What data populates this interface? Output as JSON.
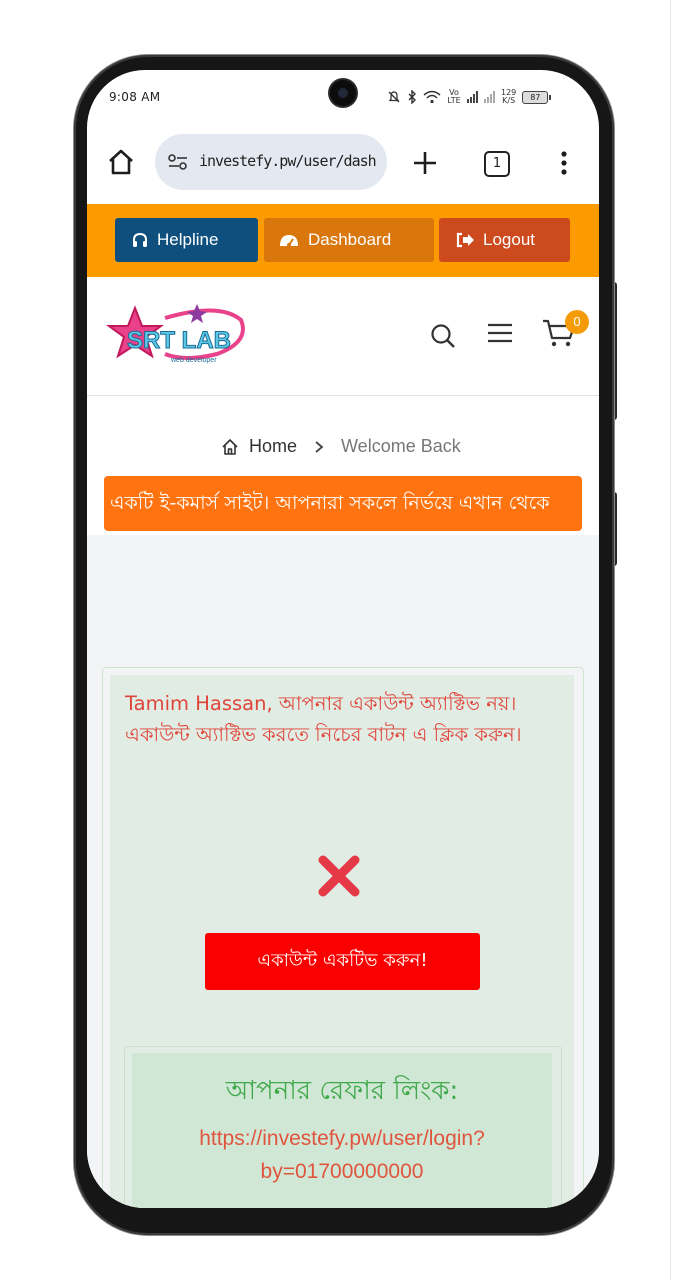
{
  "status_bar": {
    "time": "9:08 AM",
    "lte_label": "Vo LTE",
    "net_speed": "129",
    "net_unit": "K/S",
    "battery": "87"
  },
  "browser": {
    "url": "investefy.pw/user/dashboard",
    "tab_count": "1"
  },
  "topbar": {
    "helpline": "Helpline",
    "dashboard": "Dashboard",
    "logout": "Logout"
  },
  "header": {
    "logo_text": "SRT LAB",
    "logo_subtext": "web developer",
    "cart_count": "0"
  },
  "breadcrumb": {
    "home": "Home",
    "current": "Welcome Back"
  },
  "marquee": {
    "text": "একটি ই-কমার্স সাইট। আপনারা সকলে নির্ভয়ে এখান থেকে"
  },
  "account": {
    "warning": "Tamim Hassan, আপনার একাউন্ট অ্যাক্টিভ নয়। একাউন্ট অ্যাক্টিভ করতে নিচের বাটন এ ক্লিক করুন।",
    "activate_button": "একাউন্ট একটিভ করুন!"
  },
  "referral": {
    "title": "আপনার রেফার লিংক:",
    "link_line1": "https://investefy.pw/user/login?",
    "link_line2": "by=01700000000"
  },
  "colors": {
    "topbar": "#fb9b00",
    "helpline": "#0f4f7e",
    "dashboard": "#d9760c",
    "logout": "#cc4a1e",
    "marquee": "#ff7410",
    "activate": "#fb0000",
    "ref_title": "#40a94a"
  }
}
